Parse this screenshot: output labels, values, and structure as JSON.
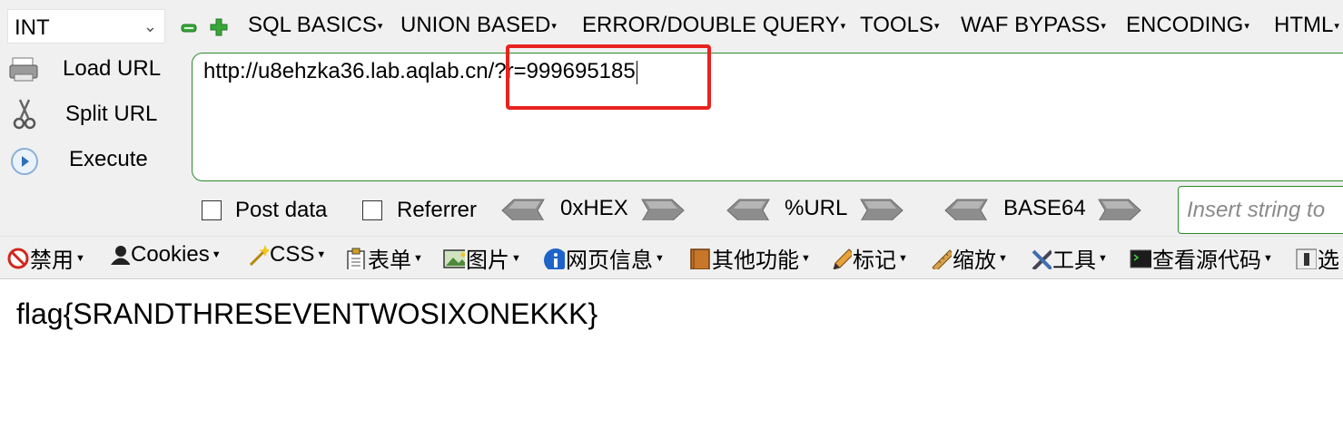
{
  "top_bar": {
    "select_value": "INT",
    "menus": [
      "SQL BASICS",
      "UNION BASED",
      "ERROR/DOUBLE QUERY",
      "TOOLS",
      "WAF BYPASS",
      "ENCODING",
      "HTML"
    ]
  },
  "side_buttons": {
    "load": "Load URL",
    "split": "Split URL",
    "execute": "Execute"
  },
  "url": {
    "value": "http://u8ehzka36.lab.aqlab.cn/?r=999695185"
  },
  "options": {
    "post_data": "Post data",
    "referrer": "Referrer",
    "hex": "0xHEX",
    "url_enc": "%URL",
    "base64": "BASE64",
    "insert_placeholder": "Insert string to"
  },
  "toolbar2": {
    "disable": "禁用",
    "cookies": "Cookies",
    "css": "CSS",
    "forms": "表单",
    "images": "图片",
    "info": "网页信息",
    "misc": "其他功能",
    "outline": "标记",
    "resize": "缩放",
    "tools": "工具",
    "source": "查看源代码",
    "options": "选"
  },
  "page": {
    "content": "flag{SRANDTHRESEVENTWOSIXONEKKK}"
  },
  "colors": {
    "toolbar_bg": "#f0f0f0",
    "url_border": "#2b8a2b",
    "highlight": "#e8231f"
  }
}
